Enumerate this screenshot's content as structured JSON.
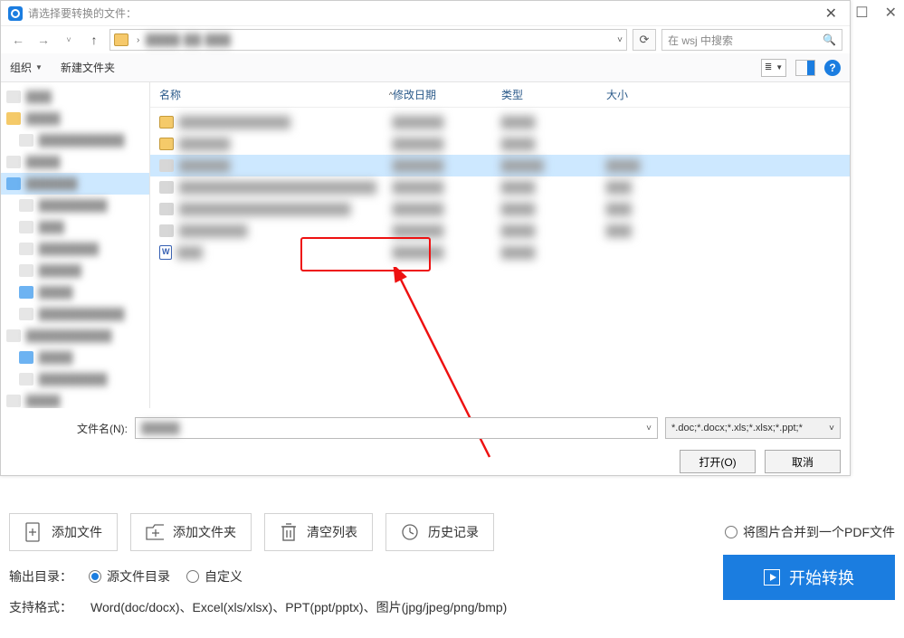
{
  "outer": {
    "maximize": "☐",
    "close": "✕"
  },
  "dialog": {
    "title": "请选择要转换的文件：",
    "close": "✕",
    "nav": {
      "back": "←",
      "forward": "→",
      "up": "↑",
      "dropdown": "˅",
      "refresh": "⟳"
    },
    "path": {
      "chev": "›",
      "drop": "˅"
    },
    "search": {
      "placeholder": "在 wsj 中搜索",
      "icon": "🔍"
    },
    "toolbar": {
      "organize": "组织",
      "newfolder": "新建文件夹",
      "view_icon": "≣",
      "help": "?"
    },
    "columns": {
      "name": "名称",
      "sort": "^",
      "date": "修改日期",
      "type": "类型",
      "size": "大小"
    },
    "filename_label": "文件名(N):",
    "filter": "*.doc;*.docx;*.xls;*.xlsx;*.ppt;*",
    "open": "打开(O)",
    "cancel": "取消"
  },
  "ops": {
    "add_file": "添加文件",
    "add_folder": "添加文件夹",
    "clear_list": "清空列表",
    "history": "历史记录",
    "merge_to_pdf": "将图片合并到一个PDF文件"
  },
  "output": {
    "label": "输出目录：",
    "source_dir": "源文件目录",
    "custom": "自定义"
  },
  "formats": {
    "label": "支持格式：",
    "value": "Word(doc/docx)、Excel(xls/xlsx)、PPT(ppt/pptx)、图片(jpg/jpeg/png/bmp)"
  },
  "convert": "开始转换"
}
